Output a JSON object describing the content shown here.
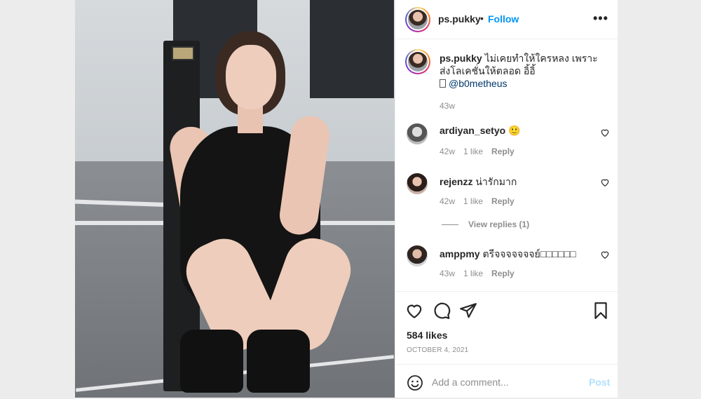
{
  "post": {
    "image_alt": "Photo by ps.pukky",
    "author": "ps.pukky",
    "follow_label": "Follow",
    "separator": "•",
    "more_label": "•••"
  },
  "caption": {
    "username": "ps.pukky",
    "text": "ไม่เคยทำให้ใครหลง เพราะส่งโลเคชั่นให้ตลอด อิ้อิ้",
    "mention": "@b0metheus",
    "time": "43w"
  },
  "comments": [
    {
      "username": "ardiyan_setyo",
      "text": "🙂",
      "time": "42w",
      "likes": "1 like",
      "reply": "Reply"
    },
    {
      "username": "rejenzz",
      "text": "น่ารักมาก",
      "time": "42w",
      "likes": "1 like",
      "reply": "Reply"
    },
    {
      "username": "amppmy",
      "text": "ตรีจจจจจจจย์□□□□□□",
      "time": "43w",
      "likes": "1 like",
      "reply": "Reply"
    }
  ],
  "view_replies": "View replies (1)",
  "actions": {
    "likes": "584 likes",
    "date": "OCTOBER 4, 2021"
  },
  "composer": {
    "placeholder": "Add a comment...",
    "post_label": "Post"
  },
  "icons": {
    "like": "heart-icon",
    "comment": "comment-bubble-icon",
    "share": "paper-plane-icon",
    "save": "bookmark-icon",
    "emoji": "emoji-smile-icon",
    "more": "more-dots-icon"
  },
  "colors": {
    "follow": "#0095f6",
    "post_button_disabled": "#b2dffc",
    "mention": "#00376b",
    "muted": "#8e8e8e"
  }
}
